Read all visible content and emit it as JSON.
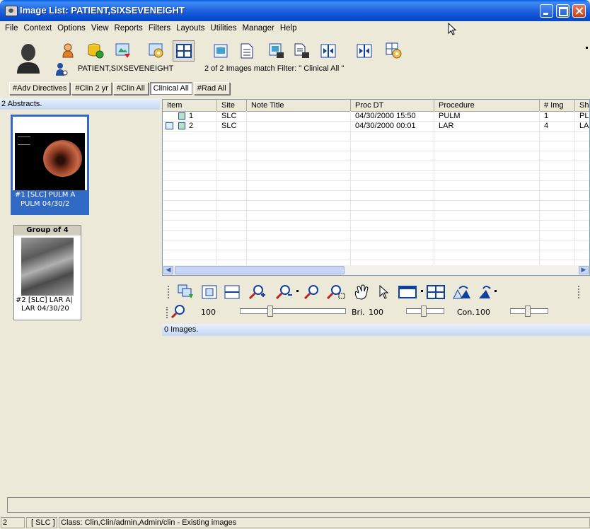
{
  "window": {
    "title": "Image List: PATIENT,SIXSEVENEIGHT"
  },
  "menu": [
    "File",
    "Context",
    "Options",
    "View",
    "Reports",
    "Filters",
    "Layouts",
    "Utilities",
    "Manager",
    "Help"
  ],
  "toolbar_icons": [
    "person-silhouette-icon",
    "patient-icon",
    "database-icon",
    "refresh-image-icon",
    "settings-image-icon",
    "layout-grid-icon",
    "image-icon",
    "document-icon",
    "image-document-icon",
    "report-document-icon",
    "split-left-icon",
    "split-right-icon",
    "config-icon"
  ],
  "patient": {
    "name": "PATIENT,SIXSEVENEIGHT",
    "filter_status": "2 of 2 Images match Filter: \" Clinical All \""
  },
  "filter_tabs": [
    {
      "label": "#Adv Directives",
      "active": false
    },
    {
      "label": "#Clin 2 yr",
      "active": false
    },
    {
      "label": "#Clin All",
      "active": false
    },
    {
      "label": "Clinical All",
      "active": true
    },
    {
      "label": "#Rad All",
      "active": false
    }
  ],
  "abstracts": {
    "header": "2 Abstracts.",
    "items": [
      {
        "line1": "#1 [SLC] PULM  A",
        "line2": "PULM 04/30/2"
      },
      {
        "group_label": "Group of 4",
        "line1": "#2 [SLC] LAR  A|",
        "line2": "LAR 04/30/20"
      }
    ]
  },
  "grid": {
    "columns": [
      "Item",
      "Site",
      "Note Title",
      "Proc DT",
      "Procedure",
      "# Img",
      "Sh"
    ],
    "rows": [
      {
        "item": "1",
        "site": "SLC",
        "note_title": "",
        "proc_dt": "04/30/2000 15:50",
        "procedure": "PULM",
        "img": "1",
        "sh": "PL"
      },
      {
        "item": "2",
        "site": "SLC",
        "note_title": "",
        "proc_dt": "04/30/2000 00:01",
        "procedure": "LAR",
        "img": "4",
        "sh": "LA"
      }
    ]
  },
  "image_tools": [
    "drag-handle-icon",
    "copy-images-icon",
    "fit-icon",
    "fit-width-icon",
    "zoom-in-icon",
    "zoom-out-icon",
    "zoom-icon",
    "zoom-rect-icon",
    "pan-hand-icon",
    "pointer-icon",
    "frame-icon",
    "layout-grid-icon",
    "rotate-icon",
    "flip-icon"
  ],
  "zoom": {
    "value": "100",
    "brightness_label": "Bri.",
    "brightness": "100",
    "contrast_label": "Con.",
    "contrast": "100"
  },
  "images_count": "0 Images.",
  "status": {
    "count": "2",
    "site": "[ SLC ]",
    "message": "Class: Clin,Clin/admin,Admin/clin - Existing images"
  }
}
